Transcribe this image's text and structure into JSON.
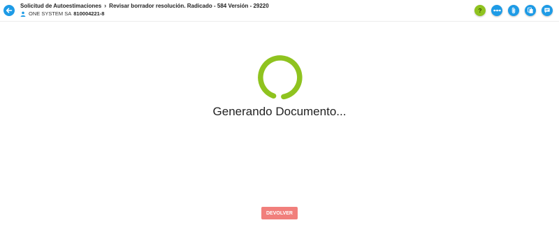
{
  "header": {
    "breadcrumb": {
      "first": "Solicitud de Autoestimaciones",
      "second": "Revisar borrador resolución. Radicado - 584 Versión - 29220"
    },
    "company_name": "ONE SYSTEM SA",
    "company_nit": "810004221-8"
  },
  "toolbar": {
    "icons": [
      "help-icon",
      "more-options-icon",
      "attachment-icon",
      "copy-documents-icon",
      "comments-icon"
    ]
  },
  "main": {
    "loading_text": "Generando Documento..."
  },
  "footer": {
    "devolver_label": "DEVOLVER"
  },
  "colors": {
    "accent_blue": "#1e9be6",
    "loader_green": "#8fc31f",
    "devolver_red": "#f17f7c"
  }
}
